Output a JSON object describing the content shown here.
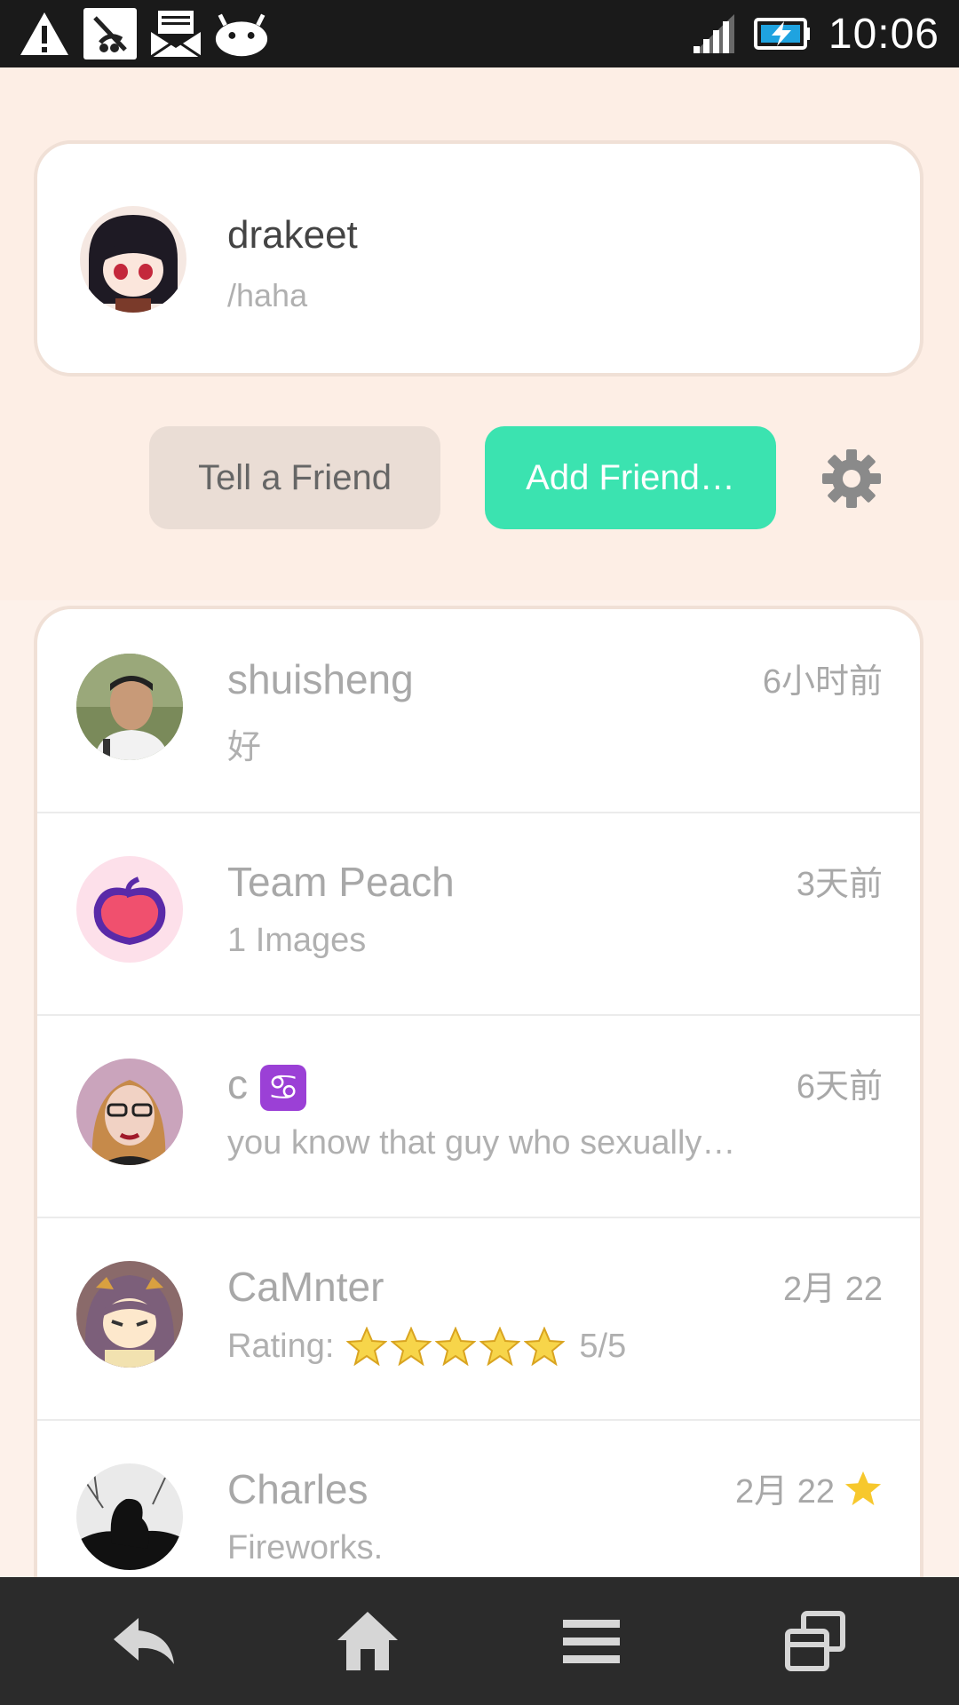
{
  "status_bar": {
    "time": "10:06",
    "icons": [
      "warning-icon",
      "no-sd-icon",
      "mail-icon",
      "android-icon",
      "signal-icon",
      "battery-charging-icon"
    ]
  },
  "profile": {
    "name": "drakeet",
    "status": "/haha"
  },
  "actions": {
    "tell_label": "Tell a Friend",
    "add_label": "Add Friend…",
    "settings_icon": "gear-icon"
  },
  "conversations": [
    {
      "name": "shuisheng",
      "time": "6小时前",
      "message": "好",
      "starred": false
    },
    {
      "name": "Team Peach",
      "time": "3天前",
      "message": "1 Images",
      "starred": false
    },
    {
      "name": "c",
      "badge": "♋",
      "time": "6天前",
      "message": "you know that guy who sexually…",
      "starred": false
    },
    {
      "name": "CaMnter",
      "time": "2月 22",
      "message_prefix": "Rating:",
      "rating": 5,
      "rating_text": "5/5",
      "starred": false
    },
    {
      "name": "Charles",
      "time": "2月 22",
      "message": "Fireworks.",
      "starred": true
    }
  ],
  "colors": {
    "accent": "#3be3b0",
    "background": "#fdf1ea",
    "star": "#f7c82d"
  },
  "nav": [
    "back-icon",
    "home-icon",
    "menu-icon",
    "recents-icon"
  ]
}
